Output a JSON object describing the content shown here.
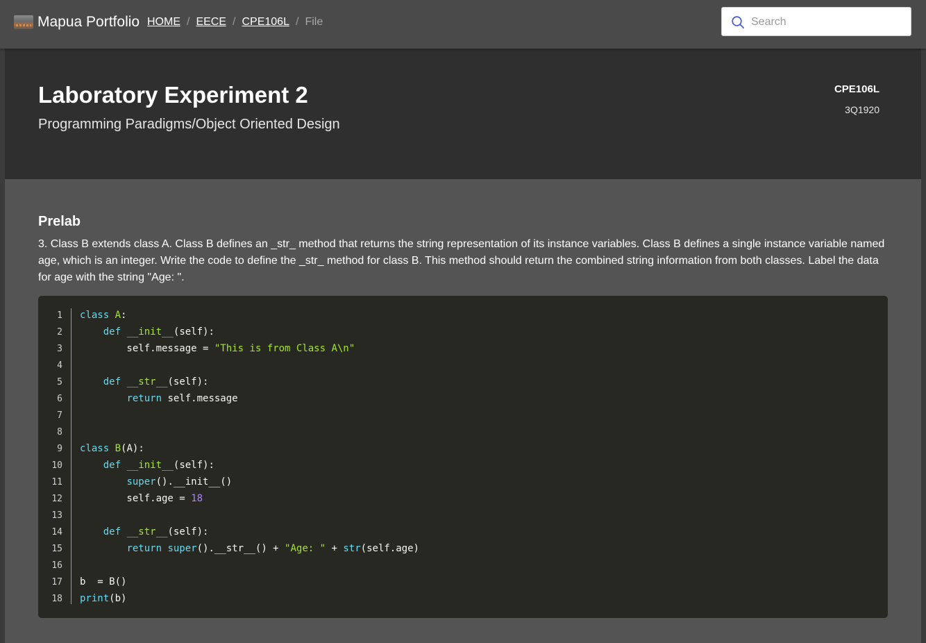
{
  "header": {
    "brand": "Mapua Portfolio",
    "breadcrumb": [
      {
        "label": "HOME"
      },
      {
        "label": "EECE"
      },
      {
        "label": "CPE106L"
      },
      {
        "label": "File"
      }
    ],
    "separator": "/",
    "search": {
      "placeholder": "Search",
      "value": ""
    }
  },
  "hero": {
    "title": "Laboratory Experiment 2",
    "subtitle": "Programming Paradigms/Object Oriented Design",
    "course_code": "CPE106L",
    "term": "3Q1920"
  },
  "section": {
    "title": "Prelab",
    "prompt": "3. Class B extends class A. Class B defines an _str_ method that returns the string representation of its instance variables. Class B defines a single instance variable named age, which is an integer. Write the code to define the _str_ method for class B. This method should return the combined string information from both classes. Label the data for age with the string \"Age: \"."
  },
  "code": {
    "language": "python",
    "line_numbers": [
      "1",
      "2",
      "3",
      "4",
      "5",
      "6",
      "7",
      "8",
      "9",
      "10",
      "11",
      "12",
      "13",
      "14",
      "15",
      "16",
      "17",
      "18"
    ],
    "lines": [
      [
        {
          "t": "class",
          "c": "kw"
        },
        {
          "t": " "
        },
        {
          "t": "A",
          "c": "cls"
        },
        {
          "t": ":"
        }
      ],
      [
        {
          "t": "    "
        },
        {
          "t": "def",
          "c": "kw"
        },
        {
          "t": " "
        },
        {
          "t": "__init__",
          "c": "fn"
        },
        {
          "t": "(self):"
        }
      ],
      [
        {
          "t": "        self.message = "
        },
        {
          "t": "\"This is from Class A\\n\"",
          "c": "str"
        }
      ],
      [],
      [
        {
          "t": "    "
        },
        {
          "t": "def",
          "c": "kw"
        },
        {
          "t": " "
        },
        {
          "t": "__str__",
          "c": "fn"
        },
        {
          "t": "(self):"
        }
      ],
      [
        {
          "t": "        "
        },
        {
          "t": "return",
          "c": "kw"
        },
        {
          "t": " self.message"
        }
      ],
      [],
      [],
      [
        {
          "t": "class",
          "c": "kw"
        },
        {
          "t": " "
        },
        {
          "t": "B",
          "c": "cls"
        },
        {
          "t": "(A):"
        }
      ],
      [
        {
          "t": "    "
        },
        {
          "t": "def",
          "c": "kw"
        },
        {
          "t": " "
        },
        {
          "t": "__init__",
          "c": "fn"
        },
        {
          "t": "(self):"
        }
      ],
      [
        {
          "t": "        "
        },
        {
          "t": "super",
          "c": "bi"
        },
        {
          "t": "().__init__()"
        }
      ],
      [
        {
          "t": "        self.age = "
        },
        {
          "t": "18",
          "c": "num"
        }
      ],
      [],
      [
        {
          "t": "    "
        },
        {
          "t": "def",
          "c": "kw"
        },
        {
          "t": " "
        },
        {
          "t": "__str__",
          "c": "fn"
        },
        {
          "t": "(self):"
        }
      ],
      [
        {
          "t": "        "
        },
        {
          "t": "return",
          "c": "kw"
        },
        {
          "t": " "
        },
        {
          "t": "super",
          "c": "bi"
        },
        {
          "t": "().__str__() + "
        },
        {
          "t": "\"Age: \"",
          "c": "str"
        },
        {
          "t": " + "
        },
        {
          "t": "str",
          "c": "bi"
        },
        {
          "t": "(self.age)"
        }
      ],
      [],
      [
        {
          "t": "b  = B()"
        }
      ],
      [
        {
          "t": "print",
          "c": "bi"
        },
        {
          "t": "(b)"
        }
      ]
    ]
  },
  "colors": {
    "topbar": "#4a4a4a",
    "hero": "#2f2f2f",
    "content": "#545454",
    "code_bg": "#272822",
    "keyword": "#66d9ef",
    "class_name": "#a6e22e",
    "string": "#a6e22e",
    "number": "#ae81ff"
  }
}
